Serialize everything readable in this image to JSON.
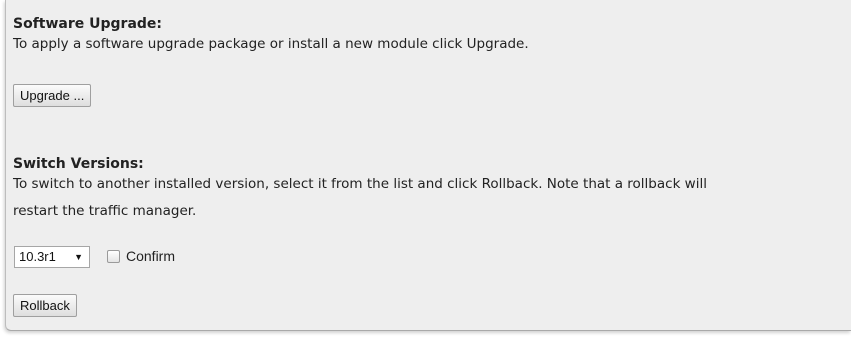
{
  "software_upgrade": {
    "title": "Software Upgrade:",
    "description": "To apply a software upgrade package or install a new module click Upgrade.",
    "button_label": "Upgrade ..."
  },
  "switch_versions": {
    "title": "Switch Versions:",
    "description_line1": "To switch to another installed version, select it from the list and click Rollback. Note that a rollback will",
    "description_line2": "restart the traffic manager.",
    "selected_version": "10.3r1",
    "select_arrow_icon": "triangle-down-icon",
    "confirm_label": "Confirm",
    "confirm_checked": false,
    "rollback_label": "Rollback"
  }
}
